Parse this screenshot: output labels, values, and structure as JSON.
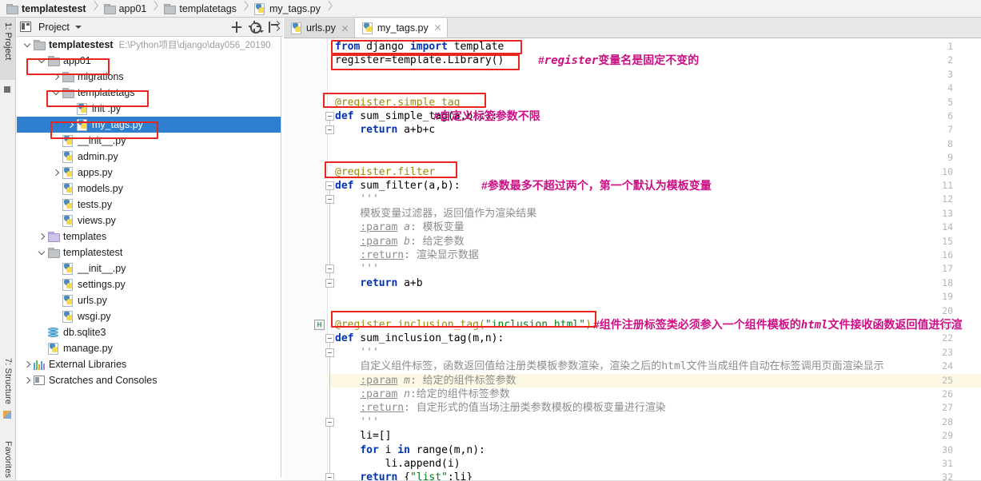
{
  "breadcrumb": {
    "items": [
      {
        "label": "templatestest",
        "icon": "folder-icon"
      },
      {
        "label": "app01",
        "icon": "folder-icon"
      },
      {
        "label": "templatetags",
        "icon": "folder-icon"
      },
      {
        "label": "my_tags.py",
        "icon": "python-file-icon"
      }
    ]
  },
  "tool_strip": {
    "project_label": "1: Project",
    "structure_label": "7: Structure",
    "favorites_label": "Favorites"
  },
  "project_panel": {
    "title": "Project",
    "tools": [
      {
        "name": "collapse-all-icon",
        "label": "Collapse All"
      },
      {
        "name": "gear-icon",
        "label": "Settings"
      },
      {
        "name": "hide-icon",
        "label": "Hide"
      }
    ],
    "tree": [
      {
        "indent": 0,
        "arrow": "down",
        "icon": "folder-icon",
        "label": "templatestest",
        "bold": true,
        "path": "E:\\Python项目\\django\\day056_20190",
        "selected": false
      },
      {
        "indent": 1,
        "arrow": "down",
        "icon": "folder-icon",
        "label": "app01",
        "bold": false,
        "path": "",
        "selected": false
      },
      {
        "indent": 2,
        "arrow": "right",
        "icon": "folder-icon",
        "label": "migrations",
        "bold": false,
        "path": "",
        "selected": false
      },
      {
        "indent": 2,
        "arrow": "down",
        "icon": "folder-icon",
        "label": "templatetags",
        "bold": false,
        "path": "",
        "selected": false
      },
      {
        "indent": 3,
        "arrow": "none",
        "icon": "python-file-icon",
        "label": "init .py",
        "bold": false,
        "path": "",
        "selected": false
      },
      {
        "indent": 3,
        "arrow": "right",
        "icon": "python-file-icon",
        "label": "my_tags.py",
        "bold": false,
        "path": "",
        "selected": true
      },
      {
        "indent": 2,
        "arrow": "none",
        "icon": "python-file-icon",
        "label": "__init__.py",
        "bold": false,
        "path": "",
        "selected": false
      },
      {
        "indent": 2,
        "arrow": "none",
        "icon": "python-file-icon",
        "label": "admin.py",
        "bold": false,
        "path": "",
        "selected": false
      },
      {
        "indent": 2,
        "arrow": "right",
        "icon": "python-file-icon",
        "label": "apps.py",
        "bold": false,
        "path": "",
        "selected": false
      },
      {
        "indent": 2,
        "arrow": "none",
        "icon": "python-file-icon",
        "label": "models.py",
        "bold": false,
        "path": "",
        "selected": false
      },
      {
        "indent": 2,
        "arrow": "none",
        "icon": "python-file-icon",
        "label": "tests.py",
        "bold": false,
        "path": "",
        "selected": false
      },
      {
        "indent": 2,
        "arrow": "none",
        "icon": "python-file-icon",
        "label": "views.py",
        "bold": false,
        "path": "",
        "selected": false
      },
      {
        "indent": 1,
        "arrow": "right",
        "icon": "folder-purple-icon",
        "label": "templates",
        "bold": false,
        "path": "",
        "selected": false
      },
      {
        "indent": 1,
        "arrow": "down",
        "icon": "folder-icon",
        "label": "templatestest",
        "bold": false,
        "path": "",
        "selected": false
      },
      {
        "indent": 2,
        "arrow": "none",
        "icon": "python-file-icon",
        "label": "__init__.py",
        "bold": false,
        "path": "",
        "selected": false
      },
      {
        "indent": 2,
        "arrow": "none",
        "icon": "python-file-icon",
        "label": "settings.py",
        "bold": false,
        "path": "",
        "selected": false
      },
      {
        "indent": 2,
        "arrow": "none",
        "icon": "python-file-icon",
        "label": "urls.py",
        "bold": false,
        "path": "",
        "selected": false
      },
      {
        "indent": 2,
        "arrow": "none",
        "icon": "python-file-icon",
        "label": "wsgi.py",
        "bold": false,
        "path": "",
        "selected": false
      },
      {
        "indent": 1,
        "arrow": "none",
        "icon": "database-icon",
        "label": "db.sqlite3",
        "bold": false,
        "path": "",
        "selected": false
      },
      {
        "indent": 1,
        "arrow": "none",
        "icon": "python-file-icon",
        "label": "manage.py",
        "bold": false,
        "path": "",
        "selected": false
      },
      {
        "indent": 0,
        "arrow": "right",
        "icon": "libraries-icon",
        "label": "External Libraries",
        "bold": false,
        "path": "",
        "selected": false
      },
      {
        "indent": 0,
        "arrow": "right",
        "icon": "scratches-icon",
        "label": "Scratches and Consoles",
        "bold": false,
        "path": "",
        "selected": false
      }
    ]
  },
  "editor": {
    "tabs": [
      {
        "label": "urls.py",
        "icon": "python-file-icon",
        "active": false
      },
      {
        "label": "my_tags.py",
        "icon": "python-file-icon",
        "active": true
      }
    ],
    "caret_line": 25,
    "gutter_marker_line": 21,
    "gutter_marker_label": "H",
    "lines": [
      {
        "n": 1,
        "text": "from django import template"
      },
      {
        "n": 2,
        "text": "register=template.Library()"
      },
      {
        "n": 3,
        "text": ""
      },
      {
        "n": 4,
        "text": ""
      },
      {
        "n": 5,
        "text": "@register.simple_tag"
      },
      {
        "n": 6,
        "text": "def sum_simple_tag(a,b,c):"
      },
      {
        "n": 7,
        "text": "    return a+b+c"
      },
      {
        "n": 8,
        "text": ""
      },
      {
        "n": 9,
        "text": ""
      },
      {
        "n": 10,
        "text": "@register.filter"
      },
      {
        "n": 11,
        "text": "def sum_filter(a,b):"
      },
      {
        "n": 12,
        "text": "    '''"
      },
      {
        "n": 13,
        "text": "    模板变量过滤器，返回值作为渲染结果"
      },
      {
        "n": 14,
        "text": "    :param a: 模板变量"
      },
      {
        "n": 15,
        "text": "    :param b: 给定参数"
      },
      {
        "n": 16,
        "text": "    :return: 渲染显示数据"
      },
      {
        "n": 17,
        "text": "    '''"
      },
      {
        "n": 18,
        "text": "    return a+b"
      },
      {
        "n": 19,
        "text": ""
      },
      {
        "n": 20,
        "text": ""
      },
      {
        "n": 21,
        "text": "@register.inclusion_tag(\"inclusion.html\")"
      },
      {
        "n": 22,
        "text": "def sum_inclusion_tag(m,n):"
      },
      {
        "n": 23,
        "text": "    '''"
      },
      {
        "n": 24,
        "text": "    自定义组件标签，函数返回值给注册类模板参数渲染，渲染之后的html文件当成组件自动在标签调用页面渲染显示"
      },
      {
        "n": 25,
        "text": "    :param m: 给定的组件标签参数"
      },
      {
        "n": 26,
        "text": "    :param n:给定的组件标签参数"
      },
      {
        "n": 27,
        "text": "    :return: 自定形式的值当场注册类参数模板的模板变量进行渲染"
      },
      {
        "n": 28,
        "text": "    '''"
      },
      {
        "n": 29,
        "text": "    li=[]"
      },
      {
        "n": 30,
        "text": "    for i in range(m,n):"
      },
      {
        "n": 31,
        "text": "        li.append(i)"
      },
      {
        "n": 32,
        "text": "    return {\"list\":li}"
      }
    ],
    "annotations": [
      {
        "line": 2,
        "text": "#register变量名是固定不变的",
        "mono_part": "register"
      },
      {
        "line": 6,
        "text": "#自定义标签参数不限",
        "mono_part": ""
      },
      {
        "line": 11,
        "text": "#参数最多不超过两个，第一个默认为模板变量",
        "mono_part": ""
      },
      {
        "line": 21,
        "text": "#组件注册标签类必须参入一个组件模板的html文件接收函数返回值进行渲",
        "mono_part": "html"
      }
    ]
  },
  "colors": {
    "selection_blue": "#2f7fd1",
    "annotation_box_red": "#e8251f",
    "comment_magenta": "#cc0f85",
    "keyword_blue": "#0033b3",
    "string_green": "#067d17",
    "decorator_gold": "#9e880d",
    "caret_line_yellow": "#fdf8e3"
  }
}
